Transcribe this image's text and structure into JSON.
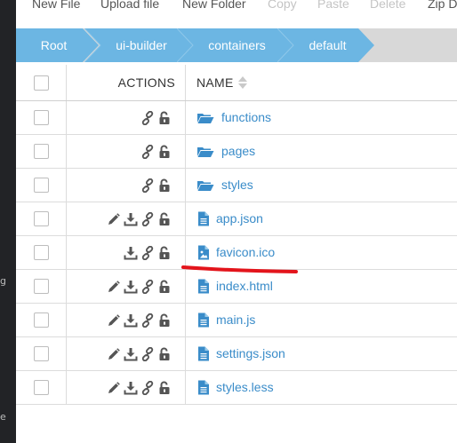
{
  "toolbar": {
    "new_file": "New File",
    "upload_file": "Upload file",
    "new_folder": "New Folder",
    "copy": "Copy",
    "paste": "Paste",
    "delete": "Delete",
    "zip": "Zip D"
  },
  "breadcrumb": {
    "items": [
      "Root",
      "ui-builder",
      "containers",
      "default"
    ]
  },
  "table": {
    "header": {
      "actions": "ACTIONS",
      "name": "NAME"
    },
    "rows": [
      {
        "name": "functions",
        "type": "folder"
      },
      {
        "name": "pages",
        "type": "folder"
      },
      {
        "name": "styles",
        "type": "folder"
      },
      {
        "name": "app.json",
        "type": "file"
      },
      {
        "name": "favicon.ico",
        "type": "image"
      },
      {
        "name": "index.html",
        "type": "file"
      },
      {
        "name": "main.js",
        "type": "file"
      },
      {
        "name": "settings.json",
        "type": "file"
      },
      {
        "name": "styles.less",
        "type": "file"
      }
    ]
  },
  "left_rail": {
    "glyph_top": "g",
    "glyph_bottom": "e"
  },
  "colors": {
    "breadcrumb_blue": "#6cb6e3",
    "link_blue": "#3a8cc9",
    "annotation_red": "#e3141b",
    "icon_gray": "#555555"
  }
}
